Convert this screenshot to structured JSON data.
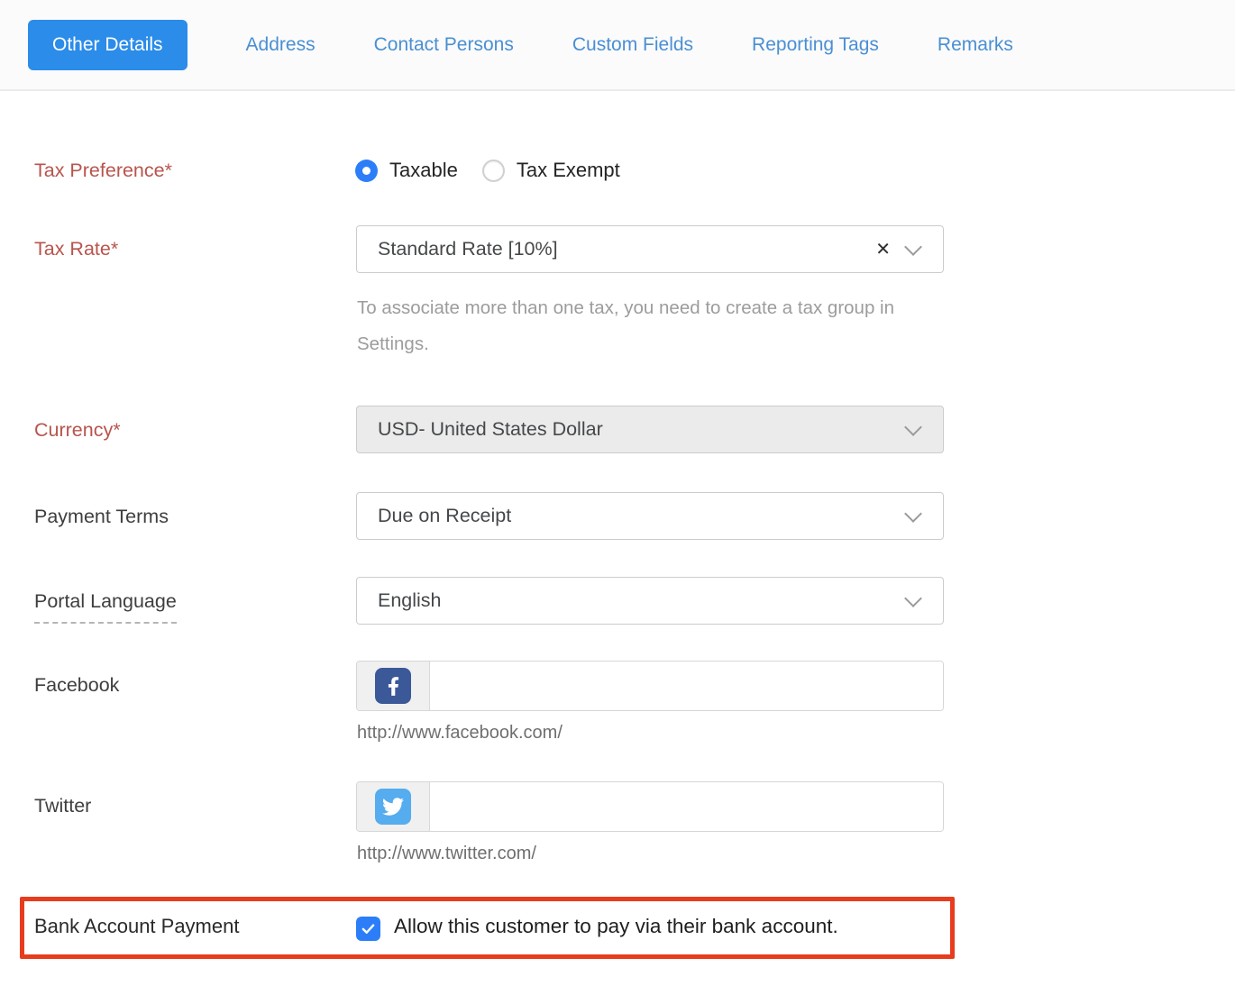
{
  "tabs": {
    "items": [
      {
        "label": "Other Details",
        "active": true
      },
      {
        "label": "Address",
        "active": false
      },
      {
        "label": "Contact Persons",
        "active": false
      },
      {
        "label": "Custom Fields",
        "active": false
      },
      {
        "label": "Reporting Tags",
        "active": false
      },
      {
        "label": "Remarks",
        "active": false
      }
    ]
  },
  "form": {
    "tax_preference": {
      "label": "Tax Preference*",
      "required": true,
      "options": [
        {
          "label": "Taxable",
          "selected": true
        },
        {
          "label": "Tax Exempt",
          "selected": false
        }
      ]
    },
    "tax_rate": {
      "label": "Tax Rate*",
      "required": true,
      "value": "Standard Rate [10%]",
      "helper": "To associate more than one tax, you need to create a tax group in Settings."
    },
    "currency": {
      "label": "Currency*",
      "required": true,
      "value": "USD- United States Dollar",
      "disabled": true
    },
    "payment_terms": {
      "label": "Payment Terms",
      "value": "Due on Receipt"
    },
    "portal_language": {
      "label": "Portal Language",
      "value": "English"
    },
    "facebook": {
      "label": "Facebook",
      "value": "",
      "helper": "http://www.facebook.com/"
    },
    "twitter": {
      "label": "Twitter",
      "value": "",
      "helper": "http://www.twitter.com/"
    },
    "bank_account_payment": {
      "label": "Bank Account Payment",
      "checked": true,
      "checkbox_label": "Allow this customer to pay via their bank account."
    }
  },
  "icons": {
    "clear": "✕",
    "facebook": "facebook-f",
    "twitter": "twitter-bird",
    "check": "checkmark",
    "chevron": "chevron-down"
  },
  "colors": {
    "active_tab": "#2b8ce9",
    "tab_link": "#4a8fd3",
    "required_label": "#b8544d",
    "control_blue": "#2c7ef8",
    "facebook": "#3b5998",
    "twitter": "#55acee",
    "annotation": "#e73c1e"
  }
}
